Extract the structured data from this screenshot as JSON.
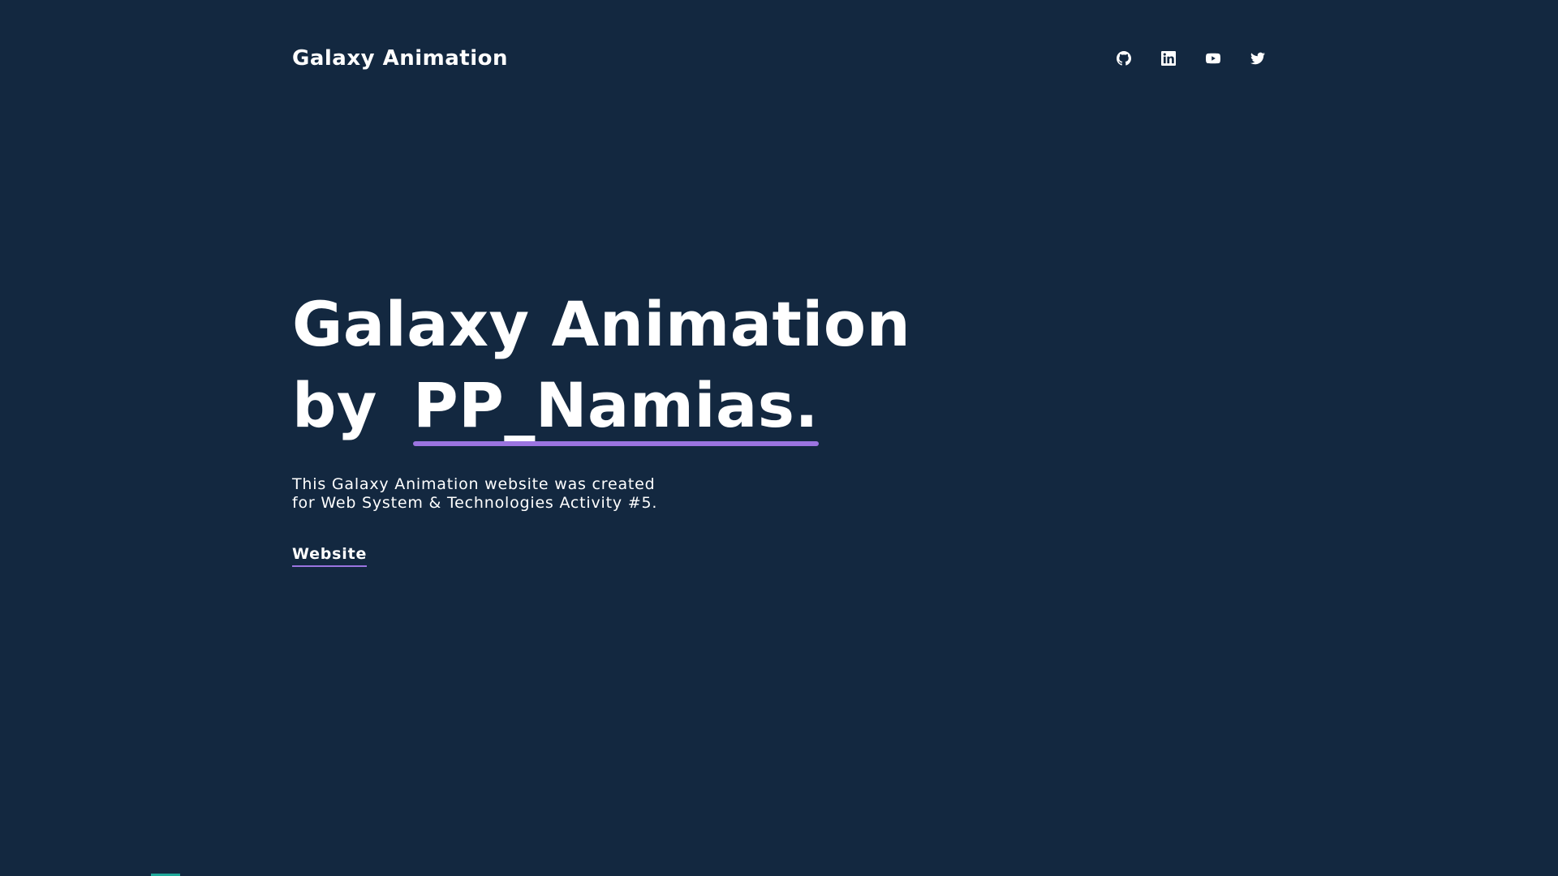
{
  "header": {
    "brand": "Galaxy Animation",
    "social": [
      {
        "icon": "github-icon"
      },
      {
        "icon": "linkedin-icon"
      },
      {
        "icon": "youtube-icon"
      },
      {
        "icon": "twitter-icon"
      }
    ]
  },
  "hero": {
    "title_line1": "Galaxy Animation",
    "title_by": "by",
    "title_name": "PP_Namias.",
    "description_line1": "This Galaxy Animation website was created",
    "description_line2": "for Web System & Technologies Activity #5.",
    "link_label": "Website"
  },
  "colors": {
    "background": "#132840",
    "text": "#ffffff",
    "accent": "#9b74e0",
    "bottom_accent": "#1fa89a"
  }
}
